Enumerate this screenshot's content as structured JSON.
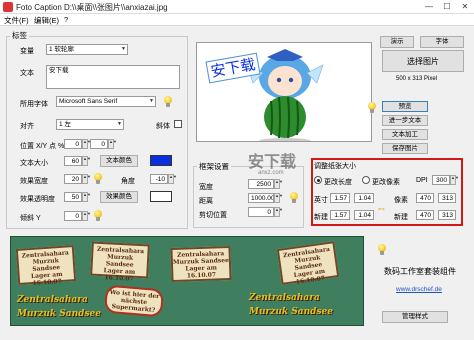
{
  "window": {
    "title": "Foto Caption D:\\\\桌面\\\\张图片\\\\anxiazai.jpg",
    "controls": [
      "—",
      "☐",
      "✕"
    ]
  },
  "menu": [
    "文件(F)",
    "编辑(E)",
    "?"
  ],
  "label_group": {
    "title": "标签",
    "variable_label": "变量",
    "variable_value": "1 软轮廓",
    "text_label": "文本",
    "text_value": "安下载",
    "font_label": "所用字体",
    "font_value": "Microsoft Sans Serif",
    "align_label": "对齐",
    "align_value": "1 左",
    "italic_label": "斜体",
    "pos_label": "位置 X/Y 点 %",
    "pos_x": "0",
    "pos_y": "0",
    "size_label": "文本大小",
    "size_value": "60",
    "text_color_btn": "文本颜色",
    "text_color": "#0a2fe0",
    "width_label": "效果宽度",
    "width_value": "20",
    "angle_label": "角度",
    "angle_value": "-10",
    "opacity_label": "效果透明度",
    "opacity_value": "50",
    "effect_color_btn": "效果颜色",
    "effect_color": "#ffffff",
    "tilt_label": "倾斜 Y",
    "tilt_value": "0"
  },
  "preview": {
    "stamp_text": "安下载"
  },
  "right_buttons": {
    "demo": "演示",
    "font": "字体",
    "select_image": "选择图片",
    "image_size": "500 x 313 Pixel",
    "preview": "预览",
    "undo": "进一步文本",
    "text_process": "文本加工",
    "save": "保存图片"
  },
  "frame_group": {
    "title": "框架设置",
    "width_label": "宽度",
    "width_value": "2500",
    "distance_label": "距离",
    "distance_value": "1000.00",
    "crop_label": "剪切位置",
    "crop_value": "0"
  },
  "resize_group": {
    "title": "调整纸张大小",
    "mode_length": "更改长度",
    "mode_pixel": "更改像素",
    "dpi_label": "DPI",
    "dpi_value": "300",
    "inch_label": "英寸",
    "inch_w": "1.57",
    "inch_h": "1.04",
    "pixel_label": "像素",
    "pixel_w": "470",
    "pixel_h": "313",
    "new_label": "新建",
    "new_inch_w": "1.57",
    "new_inch_h": "1.04",
    "new_label2": "新建",
    "new_pixel_w": "470",
    "new_pixel_h": "313"
  },
  "banner": {
    "cards": [
      [
        "Zentralsahara",
        "Murzuk Sandsee",
        "Lager am 16.10.07"
      ],
      [
        "Zentralsahara",
        "Murzuk Sandsee",
        "Lager am 16.10.07"
      ],
      [
        "Zentralsahara",
        "Murzuk Sandsee",
        "Lager am 16.10.07"
      ],
      [
        "Zentralsahara",
        "Murzuk Sandsee",
        "Lager am 16.10.07"
      ],
      [
        "Wo ist hier der",
        "nächste",
        "Supermarkt?"
      ]
    ],
    "big_text_1": "Zentralsahara",
    "big_text_2": "Murzuk Sandsee",
    "big_text_3": "Zentralsahara",
    "big_text_4": "Murzuk Sandsee"
  },
  "footer": {
    "brand": "数码工作室套装组件",
    "link": "www.drschef.de",
    "manage_btn": "管理样式"
  },
  "watermark": {
    "main": "安下载",
    "sub": "anxz.com"
  }
}
